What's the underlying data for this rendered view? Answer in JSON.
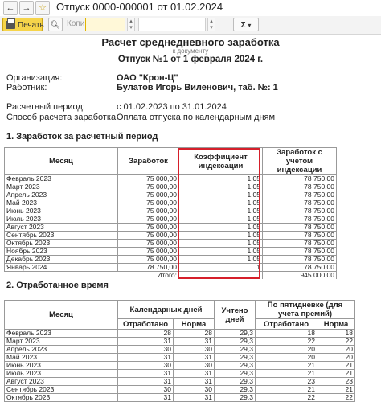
{
  "window": {
    "title": "Отпуск 0000-000001 от 01.02.2024",
    "back_glyph": "←",
    "forward_glyph": "→"
  },
  "toolbar": {
    "print_label": "Печать",
    "copies_label": "Копий",
    "copies_value": "",
    "zoom_value": "",
    "sum_label": "Σ",
    "dropdown_glyph": "▾",
    "spin_up": "▴",
    "spin_down": "▾"
  },
  "document": {
    "title": "Расчет среднедневного заработка",
    "subtitle": "к документу",
    "number_line": "Отпуск №1 от 1 февраля 2024 г.",
    "org_label": "Организация:",
    "org_value": "ОАО \"Крон-Ц\"",
    "employee_label": "Работник:",
    "employee_value": "Булатов Игорь Виленович, таб. №: 1",
    "period_label": "Расчетный период:",
    "period_value": "с 01.02.2023 по 31.01.2024",
    "method_label": "Способ расчета заработка:",
    "method_value": "Оплата отпуска по календарным дням",
    "section1": "1. Заработок за расчетный период",
    "section2": "2. Отработанное время"
  },
  "table1": {
    "headers": [
      "Месяц",
      "Заработок",
      "Коэффициент индексации",
      "Заработок с учетом индексации"
    ],
    "rows": [
      {
        "month": "Февраль 2023",
        "earn": "75 000,00",
        "coef": "1,05",
        "indexed": "78 750,00"
      },
      {
        "month": "Март 2023",
        "earn": "75 000,00",
        "coef": "1,05",
        "indexed": "78 750,00"
      },
      {
        "month": "Апрель 2023",
        "earn": "75 000,00",
        "coef": "1,05",
        "indexed": "78 750,00"
      },
      {
        "month": "Май 2023",
        "earn": "75 000,00",
        "coef": "1,05",
        "indexed": "78 750,00"
      },
      {
        "month": "Июнь 2023",
        "earn": "75 000,00",
        "coef": "1,05",
        "indexed": "78 750,00"
      },
      {
        "month": "Июль 2023",
        "earn": "75 000,00",
        "coef": "1,05",
        "indexed": "78 750,00"
      },
      {
        "month": "Август 2023",
        "earn": "75 000,00",
        "coef": "1,05",
        "indexed": "78 750,00"
      },
      {
        "month": "Сентябрь 2023",
        "earn": "75 000,00",
        "coef": "1,05",
        "indexed": "78 750,00"
      },
      {
        "month": "Октябрь 2023",
        "earn": "75 000,00",
        "coef": "1,05",
        "indexed": "78 750,00"
      },
      {
        "month": "Ноябрь 2023",
        "earn": "75 000,00",
        "coef": "1,05",
        "indexed": "78 750,00"
      },
      {
        "month": "Декабрь 2023",
        "earn": "75 000,00",
        "coef": "1,05",
        "indexed": "78 750,00"
      },
      {
        "month": "Январь 2024",
        "earn": "78 750,00",
        "coef": "1",
        "indexed": "78 750,00"
      }
    ],
    "total_label": "Итого:",
    "total_value": "945 000,00"
  },
  "table2": {
    "header_month": "Месяц",
    "header_calendar": "Календарных дней",
    "header_worked": "Отработано",
    "header_norm": "Норма",
    "header_credit": "Учтено дней",
    "header_fiveday": "По пятидневке (для учета премий)",
    "header_worked2": "Отработано",
    "header_norm2": "Норма",
    "rows": [
      {
        "month": "Февраль 2023",
        "worked": "28",
        "norm": "28",
        "credit": "29,3",
        "w5": "18",
        "n5": "18"
      },
      {
        "month": "Март 2023",
        "worked": "31",
        "norm": "31",
        "credit": "29,3",
        "w5": "22",
        "n5": "22"
      },
      {
        "month": "Апрель 2023",
        "worked": "30",
        "norm": "30",
        "credit": "29,3",
        "w5": "20",
        "n5": "20"
      },
      {
        "month": "Май 2023",
        "worked": "31",
        "norm": "31",
        "credit": "29,3",
        "w5": "20",
        "n5": "20"
      },
      {
        "month": "Июнь 2023",
        "worked": "30",
        "norm": "30",
        "credit": "29,3",
        "w5": "21",
        "n5": "21"
      },
      {
        "month": "Июль 2023",
        "worked": "31",
        "norm": "31",
        "credit": "29,3",
        "w5": "21",
        "n5": "21"
      },
      {
        "month": "Август 2023",
        "worked": "31",
        "norm": "31",
        "credit": "29,3",
        "w5": "23",
        "n5": "23"
      },
      {
        "month": "Сентябрь 2023",
        "worked": "30",
        "norm": "30",
        "credit": "29,3",
        "w5": "21",
        "n5": "21"
      },
      {
        "month": "Октябрь 2023",
        "worked": "31",
        "norm": "31",
        "credit": "29,3",
        "w5": "22",
        "n5": "22"
      }
    ]
  },
  "colors": {
    "highlight": "#d61f2a",
    "print_button": "#f6d44a"
  }
}
